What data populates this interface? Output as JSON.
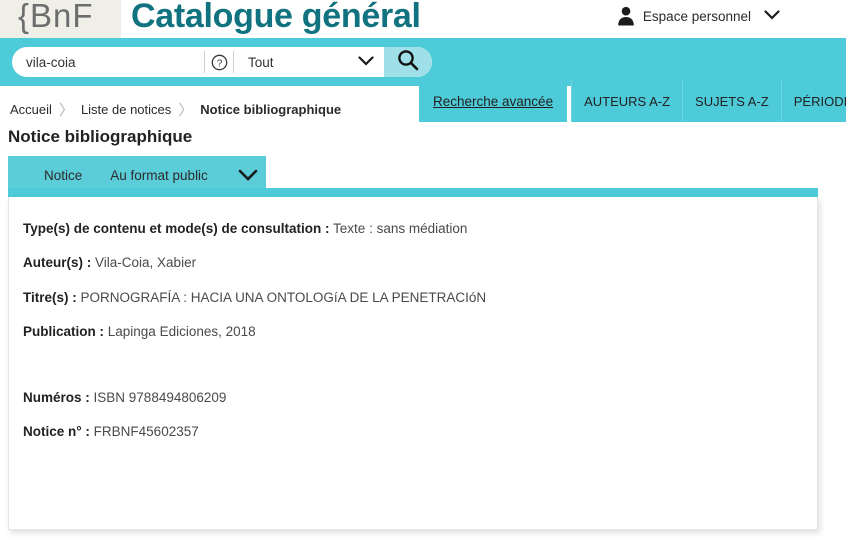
{
  "header": {
    "logo_text": "{BnF",
    "site_title": "Catalogue général",
    "account_label": "Espace personnel",
    "account_chevron": "⌄",
    "account_icon": "person-icon"
  },
  "search": {
    "value": "vila-coia",
    "placeholder": "",
    "help_icon": "question-circle-icon",
    "scope_selected": "Tout",
    "scope_chevron": "⌄",
    "search_icon": "magnifier-icon"
  },
  "nav": {
    "items": [
      {
        "label": "Recherche avancée",
        "style": "adv"
      },
      {
        "label": "AUTEURS A-Z",
        "style": "cap"
      },
      {
        "label": "SUJETS A-Z",
        "style": "cap"
      },
      {
        "label": "PÉRIODIQUES",
        "style": "cap"
      }
    ]
  },
  "breadcrumb": {
    "items": [
      "Accueil",
      "Liste de notices",
      "Notice bibliographique"
    ],
    "separator": "〉"
  },
  "page": {
    "title": "Notice bibliographique"
  },
  "tabs": {
    "items": [
      "Notice",
      "Au format public"
    ],
    "chevron": "⌄"
  },
  "record": {
    "fields": [
      {
        "label": "Type(s) de contenu et mode(s) de consultation :",
        "value": "Texte : sans médiation"
      },
      {
        "label": "Auteur(s) :",
        "value": "Vila-Coia, Xabier"
      },
      {
        "label": "Titre(s) :",
        "value": "PORNOGRAFÍA : HACIA UNA ONTOLOGíA DE LA PENETRACIóN"
      },
      {
        "label": "Publication :",
        "value": "Lapinga Ediciones, 2018"
      },
      {
        "label": "Numéros :",
        "value": "ISBN 9788494806209"
      },
      {
        "label": "Notice n° :",
        "value": "FRBNF45602357"
      }
    ]
  },
  "colors": {
    "teal_band": "#4ecbd8",
    "teal_tab": "#5bcdd8",
    "teal_search_btn": "#9fe0e8",
    "title_teal": "#11737f",
    "logo_bg": "#efeee7"
  }
}
